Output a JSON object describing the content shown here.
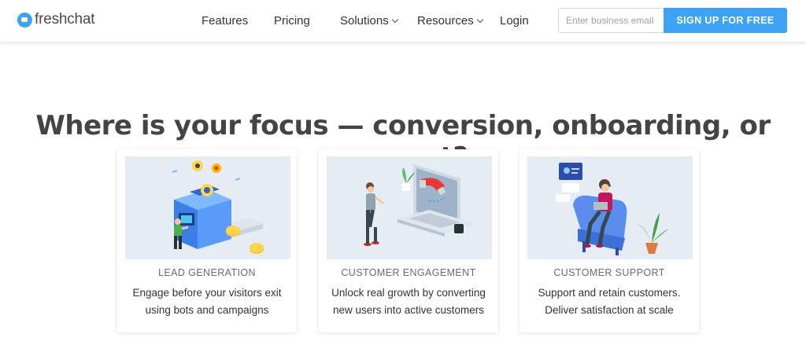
{
  "header": {
    "logo_text": "freshchat",
    "nav": [
      {
        "label": "Features"
      },
      {
        "label": "Pricing"
      },
      {
        "label": "Solutions"
      },
      {
        "label": "Resources"
      },
      {
        "label": "Login"
      }
    ],
    "email_placeholder": "Enter business email ad",
    "signup_label": "SIGN UP FOR FREE"
  },
  "main": {
    "headline": "Where is your focus — conversion, onboarding, or support?",
    "cards": [
      {
        "title": "LEAD GENERATION",
        "desc_line1": "Engage before your visitors exit",
        "desc_line2": "using bots and campaigns",
        "illustration": "lead-generation-machine-illustration"
      },
      {
        "title": "CUSTOMER ENGAGEMENT",
        "desc_line1": "Unlock real growth by converting",
        "desc_line2": "new users into active customers",
        "illustration": "laptop-magnet-illustration"
      },
      {
        "title": "CUSTOMER SUPPORT",
        "desc_line1": "Support and retain customers.",
        "desc_line2": "Deliver satisfaction at scale",
        "illustration": "support-agent-chair-illustration"
      }
    ]
  },
  "colors": {
    "accent": "#3ea3f3",
    "card_bg": "#e6ecf4",
    "text": "#333333"
  }
}
